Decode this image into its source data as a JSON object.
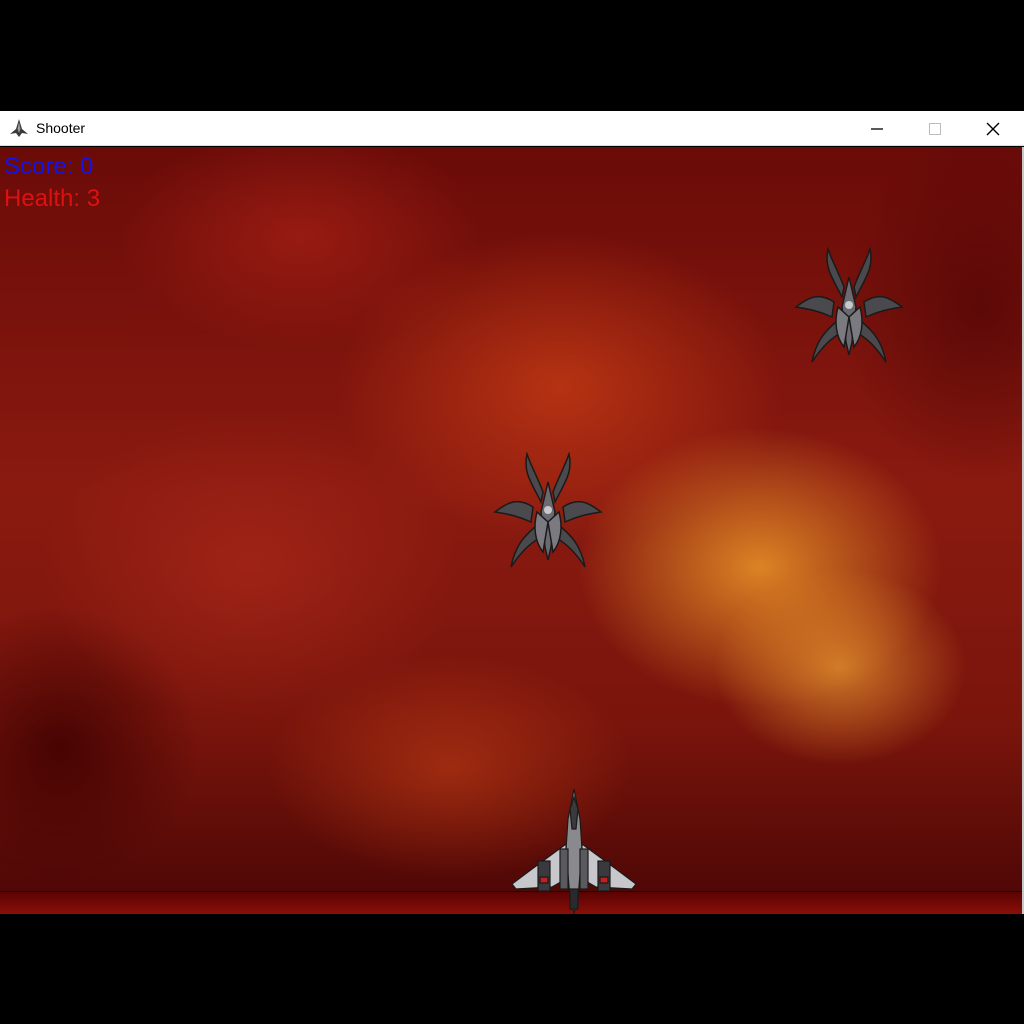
{
  "window": {
    "title": "Shooter",
    "icons": {
      "app": "spaceship-icon",
      "minimize": "minimize-icon",
      "maximize": "maximize-icon",
      "close": "close-icon"
    }
  },
  "hud": {
    "score": "Score: 0",
    "health": "Health: 3",
    "score_color": "#1414e6",
    "health_color": "#e01010"
  },
  "game": {
    "enemies": [
      {
        "name": "alien-ship"
      },
      {
        "name": "alien-ship"
      }
    ],
    "player": {
      "name": "player-ship"
    }
  }
}
